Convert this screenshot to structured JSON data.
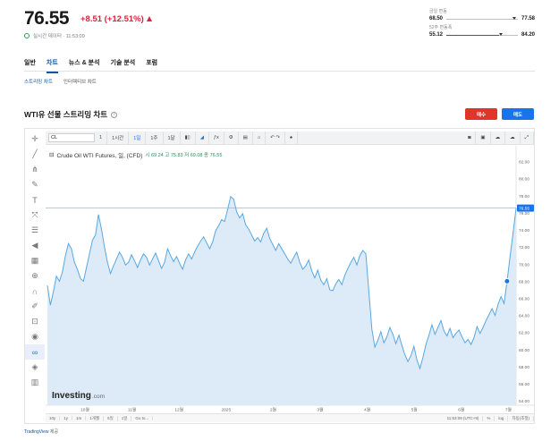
{
  "quote": {
    "price": "76.55",
    "change": "+8.51 (+12.51%)",
    "realtime_label": "실시간 데이터 · 11:53:09",
    "day_range": {
      "label": "금일 변동",
      "low": "68.50",
      "high": "77.58",
      "position": 0.92
    },
    "week52_range": {
      "label": "52주 변동폭",
      "low": "55.12",
      "high": "84.20",
      "position": 0.74
    }
  },
  "tabs": [
    {
      "label": "일반",
      "active": false
    },
    {
      "label": "차트",
      "active": true
    },
    {
      "label": "뉴스 & 분석",
      "active": false
    },
    {
      "label": "기술 분석",
      "active": false
    },
    {
      "label": "포럼",
      "active": false
    }
  ],
  "subtabs": [
    {
      "label": "스트리밍 차트",
      "active": true
    },
    {
      "label": "인터렉티브 차트",
      "active": false
    }
  ],
  "chart_header": {
    "title": "WTI유 선물 스트리밍 차트",
    "sell_label": "매수",
    "buy_label": "매도"
  },
  "toolbar": {
    "symbol": "CL",
    "items": [
      "1",
      "1시간",
      "1일",
      "1주",
      "1달"
    ],
    "active_item": "1일"
  },
  "legend": {
    "name": "Crude Oil WTI Futures, 일, (CFD)",
    "open": "시 69.24",
    "high": "고 75.83",
    "low": "저 69.08",
    "close": "종 76.55"
  },
  "bottom_bar": {
    "ranges": [
      "10y",
      "1y",
      "1m",
      "1개월",
      "5일",
      "1일",
      "Go to..."
    ],
    "time": "11:53:09 (UTC+9)",
    "right": [
      "%",
      "log",
      "자동(조정)"
    ]
  },
  "branding": {
    "watermark": "Investing",
    "watermark_suffix": ".com"
  },
  "credit": {
    "link": "TradingView",
    "suffix": " 제공"
  },
  "colors": {
    "accent": "#1256a0",
    "down": "#d6263a",
    "sell": "#e0352b",
    "buy": "#1a73e8",
    "area": "#dcebf7",
    "line": "#5aa7e0"
  },
  "chart_data": {
    "type": "area",
    "series": [
      {
        "values": [
          67.5,
          65.2,
          66.8,
          68.6,
          68.0,
          69.1,
          71.0,
          72.4,
          71.8,
          70.2,
          69.4,
          68.3,
          68.0,
          69.6,
          71.2,
          72.8,
          73.4,
          75.8,
          74.1,
          72.0,
          70.2,
          68.9,
          69.8,
          70.6,
          71.4,
          70.8,
          69.9,
          70.2,
          71.1,
          70.4,
          69.6,
          70.5,
          71.2,
          70.8,
          69.9,
          70.6,
          71.3,
          70.4,
          69.5,
          70.2,
          71.8,
          71.0,
          70.3,
          70.9,
          70.1,
          69.4,
          70.5,
          71.2,
          70.6,
          71.4,
          72.1,
          72.7,
          73.2,
          72.5,
          71.8,
          72.6,
          73.9,
          74.5,
          75.2,
          75.0,
          76.4,
          77.9,
          77.6,
          76.1,
          75.4,
          75.9,
          74.6,
          74.1,
          73.4,
          72.7,
          73.1,
          72.6,
          73.6,
          74.2,
          73.0,
          72.3,
          71.6,
          72.4,
          71.8,
          71.2,
          70.6,
          70.1,
          70.8,
          71.4,
          70.2,
          69.4,
          69.8,
          70.5,
          69.2,
          68.4,
          69.3,
          68.1,
          67.6,
          68.3,
          67.0,
          66.9,
          67.7,
          68.2,
          67.6,
          68.7,
          69.5,
          70.2,
          70.8,
          69.9,
          71.0,
          71.6,
          71.2,
          66.8,
          62.4,
          60.3,
          61.1,
          62.1,
          60.8,
          61.5,
          62.6,
          61.8,
          60.7,
          61.7,
          60.5,
          59.4,
          58.6,
          59.3,
          60.4,
          58.8,
          57.8,
          59.1,
          60.6,
          61.7,
          62.9,
          61.8,
          62.6,
          63.4,
          62.2,
          61.6,
          62.5,
          61.4,
          61.9,
          62.3,
          61.5,
          60.8,
          61.2,
          60.6,
          61.4,
          62.7,
          61.9,
          62.6,
          63.4,
          64.1,
          64.8,
          64.0,
          65.3,
          66.2,
          65.4,
          68.0,
          70.9,
          73.6,
          76.55
        ]
      }
    ],
    "x_tick_labels": [
      "10월",
      "11월",
      "12월",
      "2025",
      "2월",
      "3월",
      "4월",
      "5월",
      "6월",
      "7월"
    ],
    "y_tick_labels": [
      "54.00",
      "56.00",
      "58.00",
      "60.00",
      "62.00",
      "64.00",
      "66.00",
      "68.00",
      "70.00",
      "72.00",
      "74.00",
      "76.00",
      "78.00",
      "80.00",
      "82.00"
    ],
    "ylim": [
      53.5,
      83.0
    ],
    "last_value_label": "76.55",
    "last_point_value": 68.0,
    "grid": false
  }
}
